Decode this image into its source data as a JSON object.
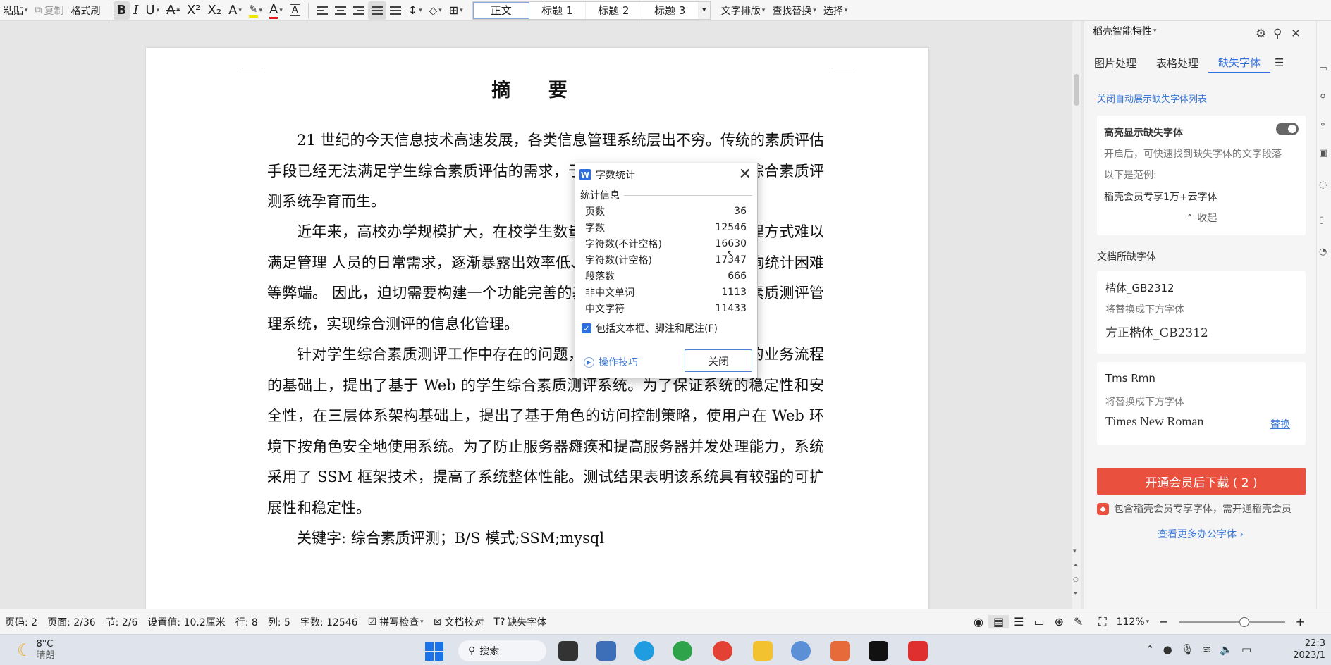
{
  "ribbon": {
    "paste": "粘贴",
    "copy": "复制",
    "format_painter": "格式刷",
    "styles": [
      "正文",
      "标题 1",
      "标题 2",
      "标题 3"
    ],
    "text_layout": "文字排版",
    "find_replace": "查找替换",
    "select": "选择"
  },
  "document": {
    "title": "摘  要",
    "paragraphs": [
      "21 世纪的今天信息技术高速发展，各类信息管理系统层出不穷。传统的素质评估手段已经无法满足学生综合素质评估的需求，于是基于计算机技术的学生综合素质评测系统孕育而生。",
      "近年来，高校办学规模扩大，在校学生数量不断增加，传统的人工管理方式难以满足管理 人员的日常需求，逐渐暴露出效率低、易出错、流程不透明、查询统计困难等弊端。 因此，迫切需要构建一个功能完善的基于 Web 环境的学生综合素质测评管理系统，实现综合测评的信息化管理。",
      "针对学生综合素质测评工作中存在的问题，在深入分析学生综合测评的业务流程 的基础上，提出了基于 Web 的学生综合素质测评系统。为了保证系统的稳定性和安全性，在三层体系架构基础上，提出了基于角色的访问控制策略，使用户在 Web 环境下按角色安全地使用系统。为了防止服务器瘫痪和提高服务器并发处理能力，系统采用了 SSM 框架技术，提高了系统整体性能。测试结果表明该系统具有较强的可扩展性和稳定性。",
      "关键字: 综合素质评测；B/S 模式;SSM;mysql"
    ]
  },
  "dialog": {
    "title": "字数统计",
    "section": "统计信息",
    "stats": [
      {
        "label": "页数",
        "value": "36"
      },
      {
        "label": "字数",
        "value": "12546"
      },
      {
        "label": "字符数(不计空格)",
        "value": "16630"
      },
      {
        "label": "字符数(计空格)",
        "value": "17347"
      },
      {
        "label": "段落数",
        "value": "666"
      },
      {
        "label": "非中文单词",
        "value": "1113"
      },
      {
        "label": "中文字符",
        "value": "11433"
      }
    ],
    "checkbox_label": "包括文本框、脚注和尾注(F)",
    "tips": "操作技巧",
    "close_button": "关闭"
  },
  "panel": {
    "title": "稻壳智能特性",
    "tabs": [
      "图片处理",
      "表格处理",
      "缺失字体"
    ],
    "auto_show_link": "关闭自动展示缺失字体列表",
    "highlight_title": "高亮显示缺失字体",
    "highlight_desc": "开启后，可快速找到缺失字体的文字段落",
    "example_label": "以下是范例:",
    "example_value": "稻壳会员专享1万+云字体",
    "collapse": "收起",
    "doc_fonts_title": "文档所缺字体",
    "fonts": [
      {
        "missing": "楷体_GB2312",
        "replace_hint": "将替换成下方字体",
        "replacement": "方正楷体_GB2312",
        "action": ""
      },
      {
        "missing": "Tms Rmn",
        "replace_hint": "将替换成下方字体",
        "replacement": "Times New Roman",
        "action": "替换"
      }
    ],
    "download_button": "开通会员后下载 ( 2 )",
    "member_note": "包含稻壳会员专享字体，需开通稻壳会员",
    "more_fonts": "查看更多办公字体"
  },
  "status": {
    "page_code": "页码: 2",
    "page": "页面: 2/36",
    "section": "节: 2/6",
    "setting": "设置值: 10.2厘米",
    "row": "行: 8",
    "col": "列: 5",
    "word_count": "字数: 12546",
    "spell_check": "拼写检查",
    "proofread": "文档校对",
    "missing_fonts": "缺失字体",
    "zoom": "112%"
  },
  "taskbar": {
    "temperature": "8°C",
    "weather": "晴朗",
    "search": "搜索",
    "time": "22:3",
    "date": "2023/1"
  },
  "colors": {
    "accent": "#2f6fde",
    "download": "#e9503e"
  }
}
